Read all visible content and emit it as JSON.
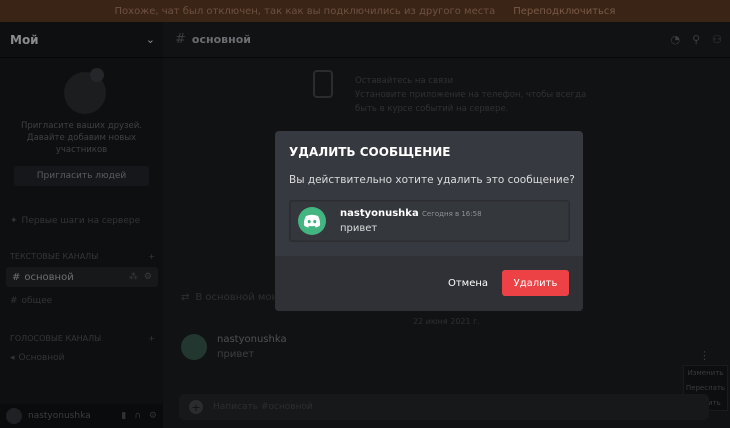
{
  "notice": {
    "text": "Похоже, чат был отключен, так как вы подключились из другого места",
    "link": "Переподключиться"
  },
  "sidebar": {
    "server_name": "Мой",
    "invite_text": "Пригласите ваших друзей. Давайте добавим новых участников",
    "invite_button": "Пригласить людей",
    "setup_item": "Первые шаги на сервере",
    "category_text": "ТЕКСТОВЫЕ КАНАЛЫ",
    "active_channel": "основной",
    "other_channel": "общее",
    "category_voice": "ГОЛОСОВЫЕ КАНАЛЫ",
    "voice_channel": "Основной"
  },
  "user": {
    "name": "nastyonushka"
  },
  "main": {
    "channel_title": "основной",
    "tip_title": "Оставайтесь на связи",
    "tip_body": "Установите приложение на телефон, чтобы всегда быть в курсе событий на сервере.",
    "welcome_text": "В основной монтаж",
    "day_separator": "22 июня 2021 г.",
    "message_author": "nastyonushka",
    "message_text": "привет",
    "composer_placeholder": "Написать #основной",
    "context_menu": [
      "Изменить",
      "Переслать",
      "Удалить"
    ]
  },
  "modal": {
    "title": "УДАЛИТЬ СООБЩЕНИЕ",
    "description": "Вы действительно хотите удалить это сообщение?",
    "preview_author": "nastyonushka",
    "preview_time": "Сегодня в 16:58",
    "preview_text": "привет",
    "cancel_label": "Отмена",
    "delete_label": "Удалить"
  },
  "colors": {
    "modal_bg": "#36393f",
    "footer_bg": "#2f3136",
    "danger": "#ed4245",
    "avatar": "#43b581"
  }
}
